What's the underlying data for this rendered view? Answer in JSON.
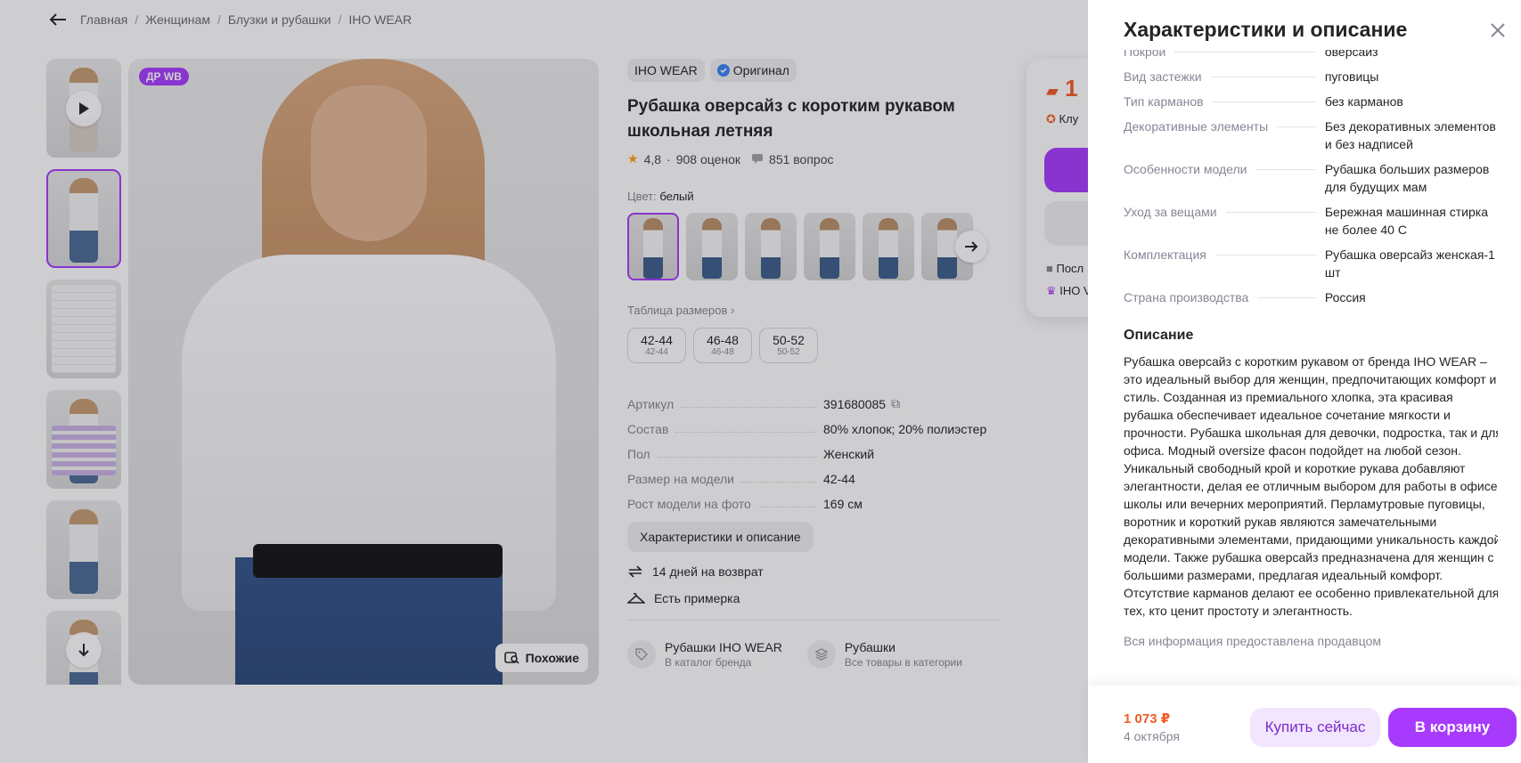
{
  "breadcrumbs": [
    "Главная",
    "Женщинам",
    "Блузки и рубашки",
    "IHO WEAR"
  ],
  "gallery": {
    "badge": "ДР WB",
    "similar_label": "Похожие"
  },
  "product": {
    "brand": "IHO WEAR",
    "original_label": "Оригинал",
    "title_line1": "Рубашка оверсайз с коротким рукавом",
    "title_line2": "школьная летняя",
    "rating": "4,8",
    "reviews": "908 оценок",
    "questions": "851 вопрос",
    "color_label": "Цвет:",
    "color_value": "белый",
    "size_table_label": "Таблица размеров",
    "sizes": [
      {
        "main": "42-44",
        "sub": "42-44"
      },
      {
        "main": "46-48",
        "sub": "46-48"
      },
      {
        "main": "50-52",
        "sub": "50-52"
      }
    ],
    "specs": [
      {
        "k": "Артикул",
        "v": "391680085"
      },
      {
        "k": "Состав",
        "v": "80% хлопок; 20% полиэстер"
      },
      {
        "k": "Пол",
        "v": "Женский"
      },
      {
        "k": "Размер на модели",
        "v": "42-44"
      },
      {
        "k": "Рост модели на фото",
        "v": "169 см"
      }
    ],
    "chars_button": "Характеристики и описание",
    "features": [
      "14 дней на возврат",
      "Есть примерка"
    ],
    "categories": [
      {
        "title": "Рубашки IHO WEAR",
        "sub": "В каталог бренда"
      },
      {
        "title": "Рубашки",
        "sub": "Все товары в категории"
      }
    ]
  },
  "buybox": {
    "price_partial": "1",
    "club_partial": "Клу",
    "line1_partial": "Посл",
    "line2_partial": "IHO V"
  },
  "panel": {
    "title": "Характеристики и описание",
    "cut_row": {
      "k": "Покрой",
      "v": "оверсайз"
    },
    "rows": [
      {
        "k": "Вид застежки",
        "v": "пуговицы"
      },
      {
        "k": "Тип карманов",
        "v": "без карманов"
      },
      {
        "k": "Декоративные элементы",
        "v": "Без декоративных элементов и без надписей"
      },
      {
        "k": "Особенности модели",
        "v": "Рубашка больших размеров для будущих мам"
      },
      {
        "k": "Уход за вещами",
        "v": "Бережная машинная стирка не более 40 С"
      },
      {
        "k": "Комплектация",
        "v": "Рубашка оверсайз женская-1 шт"
      },
      {
        "k": "Страна производства",
        "v": "Россия"
      }
    ],
    "description_heading": "Описание",
    "description": "Рубашка оверсайз с коротким рукавом от бренда IHO WEAR – это идеальный выбор для женщин, предпочитающих комфорт и стиль. Созданная из премиального хлопка, эта красивая рубашка обеспечивает идеальное сочетание мягкости и прочности. Рубашка школьная для девочки, подростка, так и для офиса. Модный oversize фасон подойдет на любой сезон. Уникальный свободный крой и короткие рукава добавляют элегантности, делая ее отличным выбором для работы в офисе, школы или вечерних мероприятий. Перламутровые пуговицы, воротник и короткий рукав являются замечательными декоративными элементами, придающими уникальность каждой модели. Также рубашка оверсайз предназначена для женщин с большими размерами, предлагая идеальный комфорт. Отсутствие карманов делают ее особенно привлекательной для тех, кто ценит простоту и элегантность.",
    "seller_note": "Вся информация предоставлена продавцом",
    "footer_price": "1 073 ₽",
    "footer_date": "4 октября",
    "buy_now": "Купить сейчас",
    "to_cart": "В корзину"
  },
  "colors": {
    "accent": "#a73afd",
    "price": "#f15b23",
    "muted": "#868695"
  }
}
